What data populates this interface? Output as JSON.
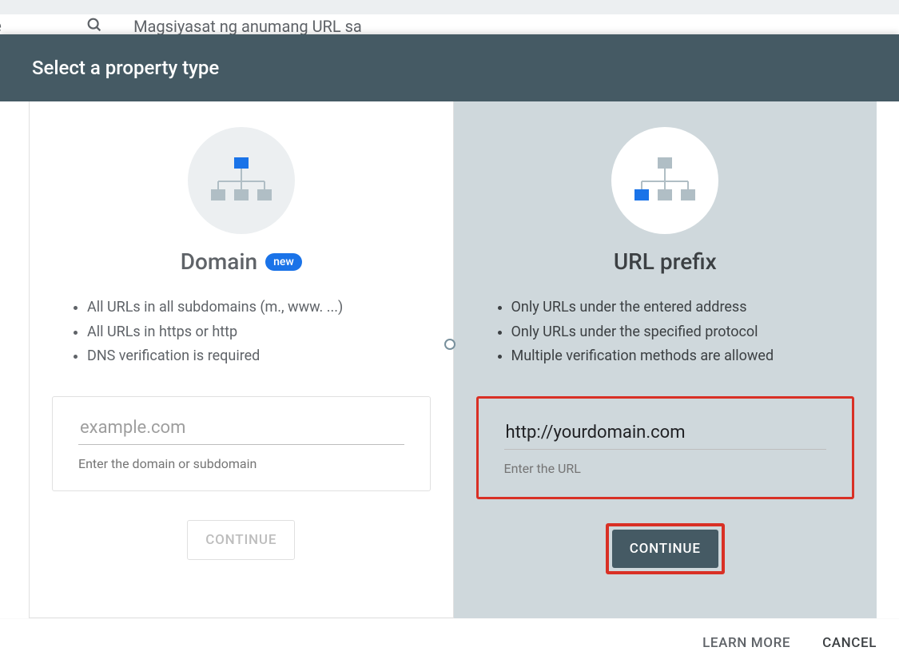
{
  "background": {
    "appFragment": "nsole",
    "urlFragment": "Magsiyasat ng anumang URL sa"
  },
  "dialog": {
    "title": "Select a property type",
    "optionA": {
      "title": "Domain",
      "badge": "new",
      "bullets": [
        "All URLs in all subdomains (m., www. ...)",
        "All URLs in https or http",
        "DNS verification is required"
      ],
      "placeholder": "example.com",
      "helper": "Enter the domain or subdomain",
      "continue": "CONTINUE"
    },
    "optionB": {
      "title": "URL prefix",
      "bullets": [
        "Only URLs under the entered address",
        "Only URLs under the specified protocol",
        "Multiple verification methods are allowed"
      ],
      "value": "http://yourdomain.com",
      "helper": "Enter the URL",
      "continue": "CONTINUE"
    },
    "footer": {
      "learnMore": "LEARN MORE",
      "cancel": "CANCEL"
    }
  }
}
